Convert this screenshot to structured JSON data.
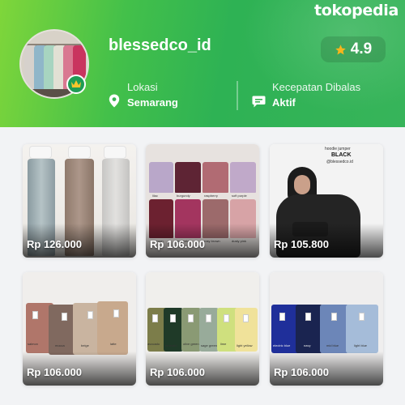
{
  "brand": "tokopedia",
  "shop": {
    "name": "blessedco_id",
    "rating": "4.9",
    "location_label": "Lokasi",
    "location_value": "Semarang",
    "response_label": "Kecepatan Dibalas",
    "response_value": "Aktif"
  },
  "products": [
    {
      "price": "Rp 126.000"
    },
    {
      "price": "Rp 106.000",
      "labels": [
        "lilac",
        "burgundy",
        "raspberry",
        "soft purple",
        "maroon",
        "magenta",
        "rosy brown",
        "dusty pink"
      ]
    },
    {
      "price": "Rp 105.800",
      "caption_title": "hoodie jumper",
      "caption_color": "BLACK",
      "caption_shop": "@blessedco.id"
    },
    {
      "price": "Rp 106.000",
      "labels": [
        "salmon",
        "mocca",
        "beige",
        "latte"
      ]
    },
    {
      "price": "Rp 106.000",
      "labels": [
        "avocado",
        "emerald",
        "olive green",
        "sage green",
        "lime",
        "light yellow"
      ]
    },
    {
      "price": "Rp 106.000",
      "labels": [
        "electric blue",
        "navy",
        "mid blue",
        "light blue"
      ]
    }
  ],
  "colors": {
    "header_green": "#2eb254",
    "star": "#f7b51c",
    "badge_green": "#1f9d55"
  }
}
